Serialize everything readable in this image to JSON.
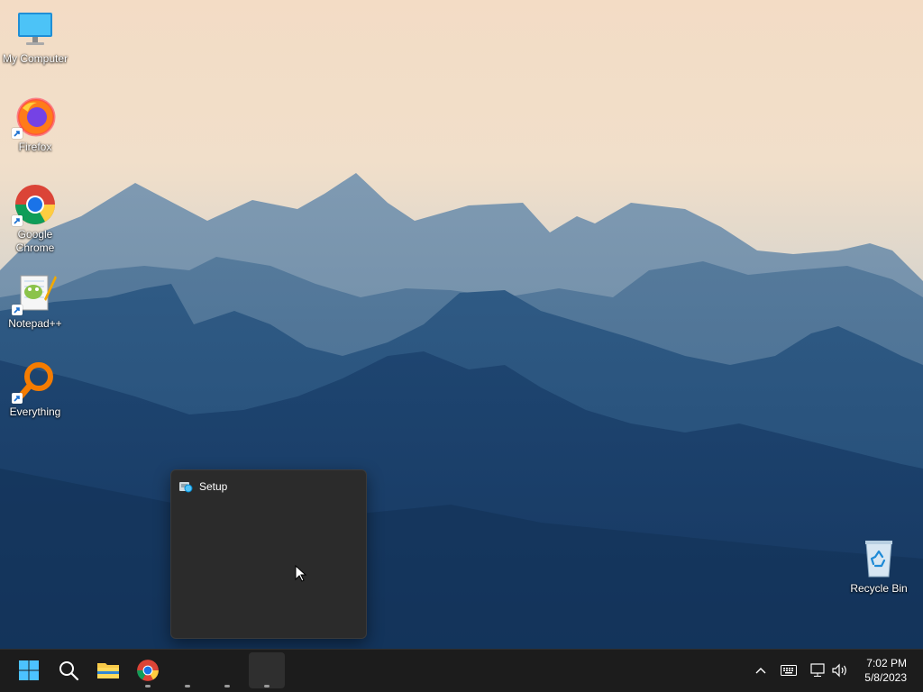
{
  "desktop": {
    "icons": [
      {
        "label": "My Computer",
        "icon": "monitor-icon"
      },
      {
        "label": "Firefox",
        "icon": "firefox-icon"
      },
      {
        "label": "Google Chrome",
        "icon": "chrome-icon"
      },
      {
        "label": "Notepad++",
        "icon": "notepadpp-icon"
      },
      {
        "label": "Everything",
        "icon": "everything-search-icon"
      },
      {
        "label": "Recycle Bin",
        "icon": "recycle-bin-icon"
      }
    ]
  },
  "taskbar_preview": {
    "title": "Setup",
    "icon": "setup-icon"
  },
  "taskbar": {
    "items": [
      {
        "name": "start",
        "icon": "windows-start-icon"
      },
      {
        "name": "search",
        "icon": "search-icon"
      },
      {
        "name": "file-explorer",
        "icon": "folder-icon"
      },
      {
        "name": "chrome",
        "icon": "chrome-icon"
      },
      {
        "name": "app-1",
        "icon": "blank-icon"
      },
      {
        "name": "app-2",
        "icon": "blank-icon"
      },
      {
        "name": "setup",
        "icon": "setup-icon"
      }
    ],
    "tray": {
      "icons": [
        "chevron-up-icon",
        "keyboard-icon",
        "network-icon",
        "volume-icon"
      ],
      "time": "7:02 PM",
      "date": "5/8/2023"
    }
  },
  "colors": {
    "taskbar_bg": "#1c1c1c",
    "preview_bg": "#2b2b2b",
    "sky_top": "#f2dcc4",
    "mountain_deep": "#1d3d66"
  }
}
